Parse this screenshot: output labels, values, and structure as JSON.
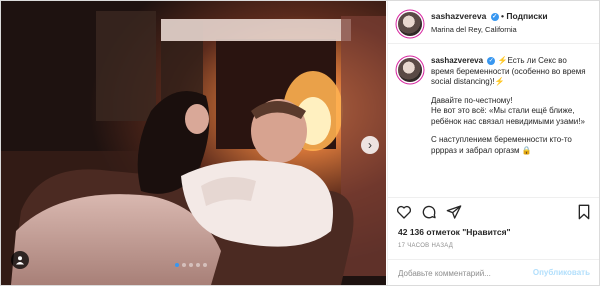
{
  "post": {
    "username": "sashazvereva",
    "follow_label": "Подписки",
    "location": "Marina del Rey, California",
    "verified_glyph": "✓"
  },
  "caption": {
    "username": "sashazvereva",
    "p1": "Есть ли Секс во время беременности (особенно во время social distancing)!",
    "p2a": "Давайте по-честному!",
    "p2b": "Не вот это всё: «Мы стали ещё ближе, ребёнок нас связал невидимыми узами!»",
    "p3": "С наступлением беременности кто-то ррррaз и забрал оргазм"
  },
  "stats": {
    "likes": "42 136 отметок \"Нравится\"",
    "time_ago": "17 ЧАСОВ НАЗАД"
  },
  "comment": {
    "placeholder": "Добавьте комментарий...",
    "publish_label": "Опубликовать"
  },
  "icons": {
    "heart": "heart-icon",
    "comment": "comment-icon",
    "share": "share-icon",
    "bookmark": "bookmark-icon",
    "next": "chevron-right-icon",
    "tag": "user-tag-icon"
  },
  "carousel": {
    "count": 5,
    "active": 1
  },
  "colors": {
    "accent": "#3897f0",
    "publish_disabled": "#b2dffc",
    "muted": "#8e8e8e"
  }
}
